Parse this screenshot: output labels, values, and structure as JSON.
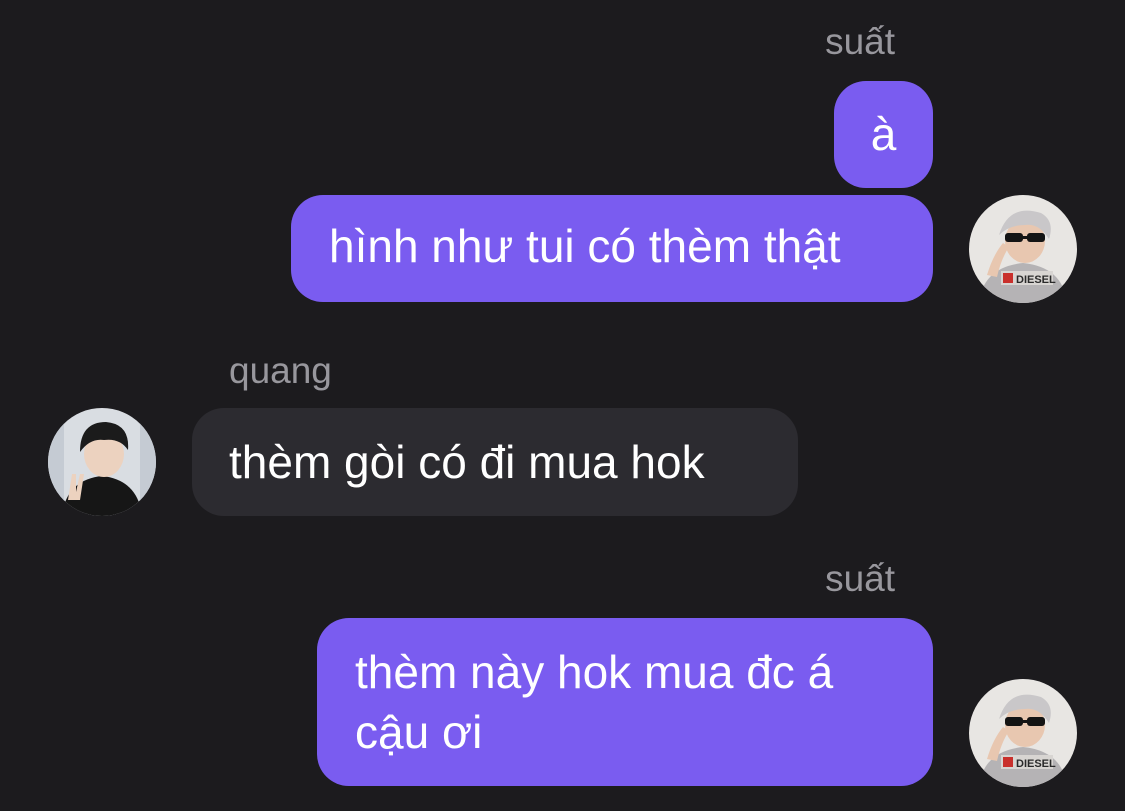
{
  "messages": [
    {
      "sender": "suất",
      "text": "à"
    },
    {
      "text": "hình như tui có thèm thật"
    },
    {
      "sender": "quang",
      "text": "thèm gòi có đi mua hok"
    },
    {
      "sender": "suất",
      "text": "thèm này hok mua đc á\ncậu ơi"
    }
  ],
  "avatars": {
    "suat": {
      "icon": "user-avatar-photo",
      "shirt_text": "DIESEL"
    },
    "quang": {
      "icon": "user-avatar-photo"
    }
  },
  "colors": {
    "background": "#1c1b1e",
    "outgoing_bubble": "#7a5cf0",
    "incoming_bubble": "#2c2b30",
    "sender_name": "#98979d"
  }
}
